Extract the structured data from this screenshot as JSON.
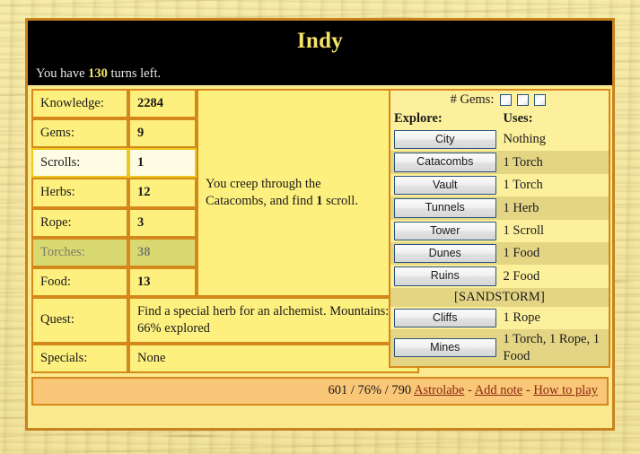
{
  "header": {
    "title": "Indy",
    "turns_prefix": "You have ",
    "turns_value": "130",
    "turns_suffix": " turns left."
  },
  "stats": {
    "rows": [
      {
        "label": "Knowledge:",
        "value": "2284",
        "state": "normal"
      },
      {
        "label": "Gems:",
        "value": "9",
        "state": "normal"
      },
      {
        "label": "Scrolls:",
        "value": "1",
        "state": "highlight"
      },
      {
        "label": "Herbs:",
        "value": "12",
        "state": "normal"
      },
      {
        "label": "Rope:",
        "value": "3",
        "state": "normal"
      },
      {
        "label": "Torches:",
        "value": "38",
        "state": "dim"
      },
      {
        "label": "Food:",
        "value": "13",
        "state": "normal"
      }
    ],
    "quest_label": "Quest:",
    "quest_line1": "Find a special herb for an alchemist.",
    "quest_line2": "Mountains: 66% explored",
    "specials_label": "Specials:",
    "specials_value": "None"
  },
  "message": {
    "line1": "You creep through the",
    "line2_pre": "Catacombs, and find ",
    "line2_bold": "1",
    "line2_post": " scroll."
  },
  "explore": {
    "gems_label": "# Gems:",
    "gem_checkbox_count": 3,
    "head_explore": "Explore:",
    "head_uses": "Uses:",
    "rows": [
      {
        "button": "City",
        "uses": "Nothing",
        "alt": false
      },
      {
        "button": "Catacombs",
        "uses": "1 Torch",
        "alt": true
      },
      {
        "button": "Vault",
        "uses": "1 Torch",
        "alt": false
      },
      {
        "button": "Tunnels",
        "uses": "1 Herb",
        "alt": true
      },
      {
        "button": "Tower",
        "uses": "1 Scroll",
        "alt": false
      },
      {
        "button": "Dunes",
        "uses": "1 Food",
        "alt": true
      },
      {
        "button": "Ruins",
        "uses": "2 Food",
        "alt": false
      }
    ],
    "sandstorm_label": "[SANDSTORM]",
    "rows_after": [
      {
        "button": "Cliffs",
        "uses": "1 Rope",
        "alt": false
      },
      {
        "button": "Mines",
        "uses": "1 Torch, 1 Rope, 1 Food",
        "alt": true
      }
    ]
  },
  "footer": {
    "score": "601 / 76% / 790",
    "link_astrolabe": "Astrolabe",
    "link_add_note": "Add note",
    "link_how_to_play": "How to play",
    "separator": "-"
  },
  "colors": {
    "frame_border": "#c8821e",
    "header_bg": "#000000",
    "title_text": "#f5e36a",
    "panel_bg": "#fbe98e",
    "cell_bg": "#fdf07e",
    "cell_border": "#d4881c",
    "highlight_bg": "#fffce4",
    "dim_bg": "#d9d972",
    "alt_row_bg": "#e4d585",
    "quest_bg": "#fac678",
    "link": "#8b2b12"
  }
}
